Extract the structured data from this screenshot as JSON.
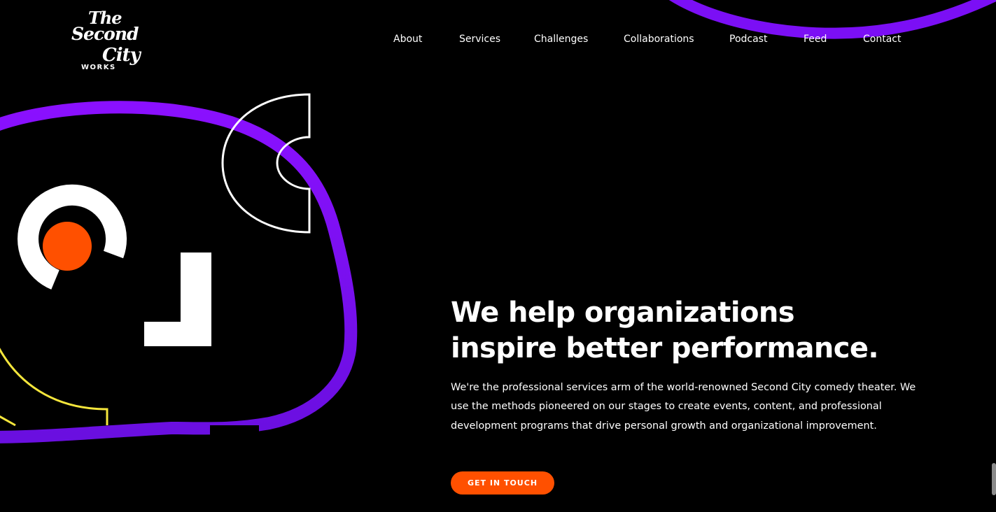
{
  "brand": {
    "logo_line1": "The",
    "logo_line2": "Second",
    "logo_line3": "City",
    "logo_line4": "WORKS"
  },
  "nav": {
    "items": [
      {
        "label": "About"
      },
      {
        "label": "Services"
      },
      {
        "label": "Challenges"
      },
      {
        "label": "Collaborations"
      },
      {
        "label": "Podcast"
      },
      {
        "label": "Feed"
      },
      {
        "label": "Contact"
      }
    ]
  },
  "hero": {
    "headline_line1": "We help organizations",
    "headline_line2": "inspire better performance.",
    "description": "We're the professional services arm of the world-renowned Second City comedy theater. We use the methods pioneered on our stages to create events, content, and professional development programs that drive personal growth and organizational improvement.",
    "cta_label": "GET IN TOUCH"
  },
  "colors": {
    "background": "#000000",
    "accent_purple": "#7b0ff5",
    "accent_orange": "#ff5000",
    "accent_yellow": "#f5e63c",
    "text": "#ffffff"
  }
}
